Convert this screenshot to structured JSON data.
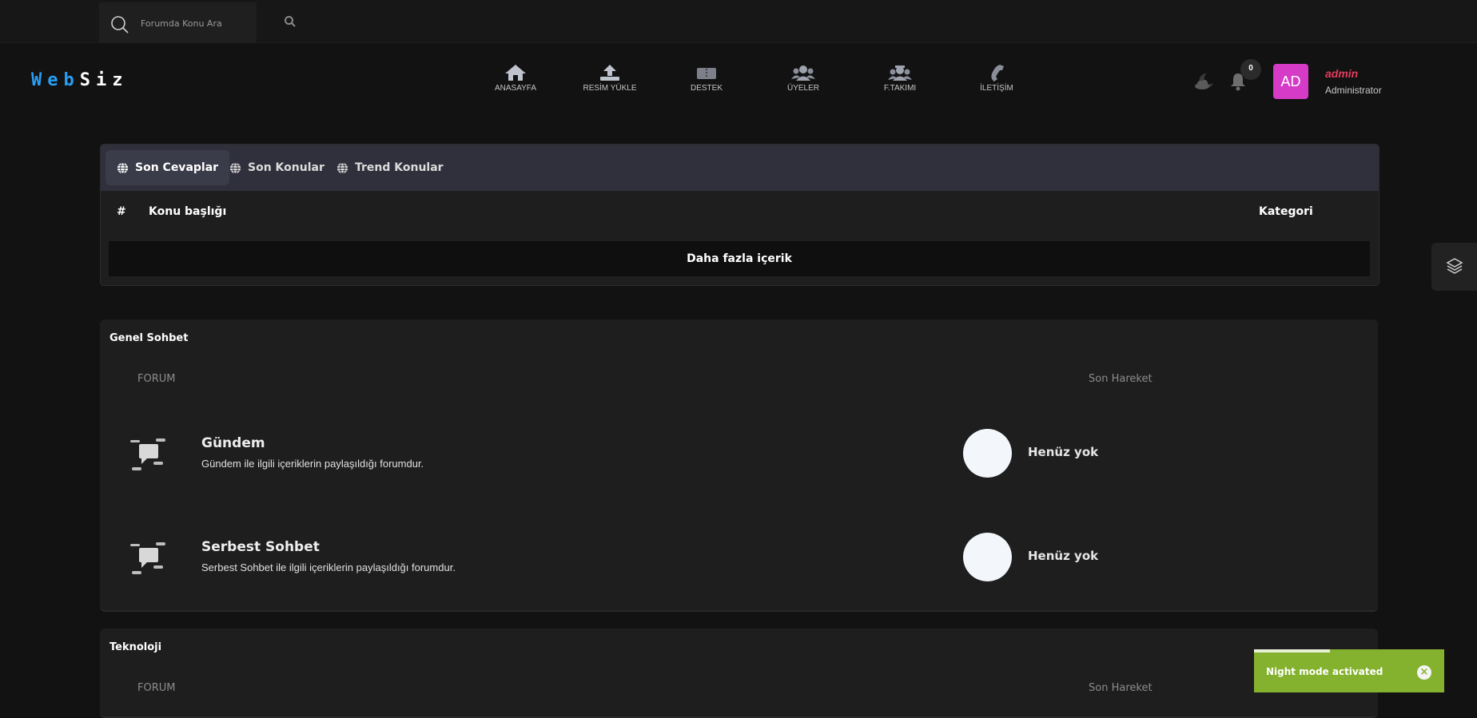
{
  "search": {
    "placeholder": "Forumda Konu Ara"
  },
  "logo": {
    "part1": "Web",
    "part2": "Siz"
  },
  "nav": [
    {
      "label": "ANASAYFA",
      "icon": "home-icon"
    },
    {
      "label": "RESİM YÜKLE",
      "icon": "upload-icon"
    },
    {
      "label": "DESTEK",
      "icon": "ticket-icon"
    },
    {
      "label": "ÜYELER",
      "icon": "users-icon"
    },
    {
      "label": "F.TAKIMI",
      "icon": "team-icon"
    },
    {
      "label": "İLETİŞİM",
      "icon": "phone-icon"
    }
  ],
  "notifications": {
    "count": "0"
  },
  "user": {
    "initials": "AD",
    "name": "admin",
    "role": "Administrator",
    "avatar_color": "#d53bc7",
    "name_color": "#e53c5e"
  },
  "tabs": [
    {
      "label": "Son Cevaplar",
      "active": true
    },
    {
      "label": "Son Konular",
      "active": false
    },
    {
      "label": "Trend Konular",
      "active": false
    }
  ],
  "table": {
    "col_num": "#",
    "col_title": "Konu başlığı",
    "col_category": "Kategori"
  },
  "more_button": "Daha fazla içerik",
  "categories": [
    {
      "title": "Genel Sohbet",
      "col_forum": "FORUM",
      "col_last": "Son Hareket",
      "forums": [
        {
          "name": "Gündem",
          "desc": "Gündem ile ilgili içeriklerin paylaşıldığı forumdur.",
          "last": "Henüz yok"
        },
        {
          "name": "Serbest Sohbet",
          "desc": "Serbest Sohbet ile ilgili içeriklerin paylaşıldığı forumdur.",
          "last": "Henüz yok"
        }
      ]
    },
    {
      "title": "Teknoloji",
      "col_forum": "FORUM",
      "col_last": "Son Hareket",
      "forums": []
    }
  ],
  "toast": {
    "text": "Night mode activated",
    "close": "×",
    "color": "#84b22e"
  }
}
